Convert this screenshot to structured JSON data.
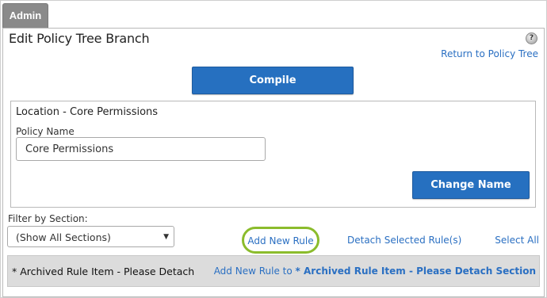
{
  "admin_tab": {
    "label": "Admin"
  },
  "page": {
    "title": "Edit Policy Tree Branch",
    "help_icon": "help-icon",
    "return_link": "Return to Policy Tree",
    "compile_button": "Compile"
  },
  "location": {
    "title": "Location - Core Permissions",
    "policy_name_label": "Policy Name",
    "policy_name_value": "Core Permissions",
    "change_name_button": "Change Name"
  },
  "filter": {
    "label": "Filter by Section:",
    "selected": "(Show All Sections)"
  },
  "actions": {
    "add_new_rule": "Add New Rule",
    "detach_selected": "Detach Selected Rule(s)",
    "select_all": "Select All"
  },
  "archived": {
    "label": "* Archived Rule Item - Please Detach",
    "add_prefix": "Add New Rule to",
    "add_target": "* Archived Rule Item - Please Detach Section"
  },
  "colors": {
    "primary_button": "#2670c0",
    "link": "#2a6fc2",
    "highlight_ring": "#8bbc2c",
    "admin_tab": "#8a8a8a",
    "archived_bar": "#dcdcdc"
  }
}
